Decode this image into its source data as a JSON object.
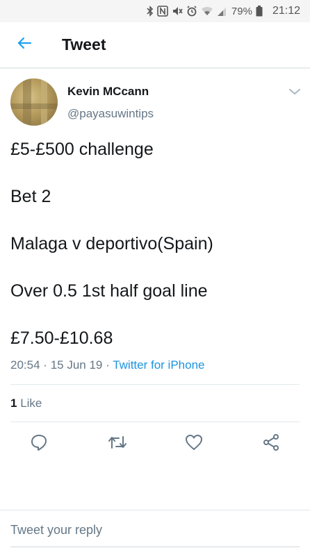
{
  "status_bar": {
    "icons": [
      "bluetooth-icon",
      "nfc-icon",
      "mute-icon",
      "alarm-icon",
      "wifi-icon",
      "signal-icon",
      "battery-icon"
    ],
    "battery": "79%",
    "time": "21:12"
  },
  "header": {
    "back_icon": "arrow-left-icon",
    "title": "Tweet",
    "accent": "#1da1f2"
  },
  "tweet": {
    "author_name": "Kevin MCcann",
    "author_handle": "@payasuwintips",
    "lines": [
      "£5-£500 challenge",
      "Bet 2",
      "Malaga v deportivo(Spain)",
      "Over 0.5 1st half goal line",
      "£7.50-£10.68"
    ],
    "time": "20:54",
    "separator": "·",
    "date": "15 Jun 19",
    "source": "Twitter for iPhone",
    "like_count": "1",
    "like_label": "Like"
  },
  "actions": [
    "reply-icon",
    "retweet-icon",
    "like-icon",
    "share-icon"
  ],
  "reply": {
    "placeholder": "Tweet your reply"
  }
}
